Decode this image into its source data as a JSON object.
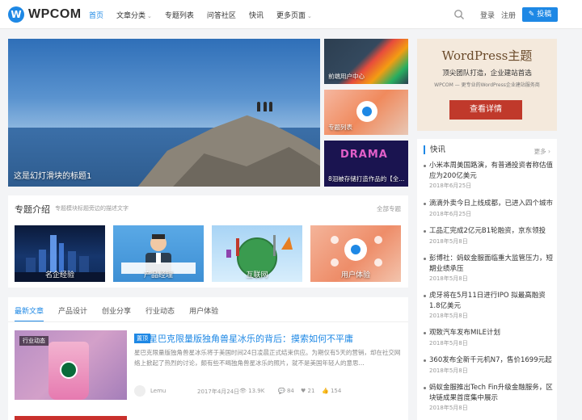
{
  "header": {
    "logo_mark": "W",
    "logo_text": "WPCOM",
    "nav": [
      {
        "label": "首页",
        "active": true,
        "has_caret": false
      },
      {
        "label": "文章分类",
        "active": false,
        "has_caret": true
      },
      {
        "label": "专题列表",
        "active": false,
        "has_caret": false
      },
      {
        "label": "问答社区",
        "active": false,
        "has_caret": false
      },
      {
        "label": "快讯",
        "active": false,
        "has_caret": false
      },
      {
        "label": "更多页面",
        "active": false,
        "has_caret": true
      }
    ],
    "caret": "⌄",
    "login": "登录",
    "register": "注册",
    "submit": "投稿",
    "accent_color": "#1e88e5"
  },
  "slider": {
    "caption": "这是幻灯滑块的标题1"
  },
  "thumbs": [
    {
      "label": "前端用户中心"
    },
    {
      "label": "专题列表"
    },
    {
      "label": "8泪被存储打造作品的【全..."
    }
  ],
  "thumb3_word": "DRAMA",
  "ad": {
    "title": "WordPress主题",
    "subtitle": "顶尖团队打造，企业建站首选",
    "small": "WPCOM — 更专业的WordPress企业建站服务商",
    "button": "查看详情"
  },
  "kuaixun": {
    "title": "快讯",
    "more": "更多 ›",
    "items": [
      {
        "title": "小米本周美国路演，有普通投资者称估值应为200亿美元",
        "date": "2018年6月25日"
      },
      {
        "title": "滴滴外卖今日上线成都，已进入四个城市",
        "date": "2018年6月25日"
      },
      {
        "title": "工品汇完成2亿元B1轮融资，京东领投",
        "date": "2018年5月8日"
      },
      {
        "title": "彭博社：蚂蚁金服面临重大监管压力，短期业绩承压",
        "date": "2018年5月8日"
      },
      {
        "title": "虎牙将在5月11日进行IPO 拟最高融资1.8亿美元",
        "date": "2018年5月8日"
      },
      {
        "title": "观致汽车发布MILE计划",
        "date": "2018年5月8日"
      },
      {
        "title": "360发布全新千元机N7，售价1699元起",
        "date": "2018年5月8日"
      },
      {
        "title": "蚂蚁金服推出Tech Fin升级金融服务，区块链成果首度集中展示",
        "date": "2018年5月8日"
      }
    ]
  },
  "topics": {
    "title": "专题介绍",
    "desc": "专题模块标题旁边的描述文字",
    "all": "全部专题",
    "items": [
      {
        "label": "名企经验"
      },
      {
        "label": "产品经理"
      },
      {
        "label": "互联网"
      },
      {
        "label": "用户体验"
      }
    ]
  },
  "articles": {
    "tabs": [
      {
        "label": "最新文章",
        "active": true
      },
      {
        "label": "产品设计",
        "active": false
      },
      {
        "label": "创业分享",
        "active": false
      },
      {
        "label": "行业动态",
        "active": false
      },
      {
        "label": "用户体验",
        "active": false
      }
    ],
    "item": {
      "tag": "行业动态",
      "badge": "置顶",
      "title": "星巴克限量版独角兽星冰乐的背后：摸索如何不平庸",
      "excerpt": "星巴克限量版独角兽星冰乐将于美国时间24日凌晨正式结束供应。为期仅有5天的营销，却在社交网络上掀起了热烈的讨论，颇有些不喝独角兽星冰乐的照片，就不是美国年轻人的意思...",
      "author": "Lemu",
      "date": "2017年4月24日",
      "views": "👁 13.9K",
      "comments": "💬 84",
      "likes": "♥ 21",
      "favorites": "👍 154"
    }
  }
}
